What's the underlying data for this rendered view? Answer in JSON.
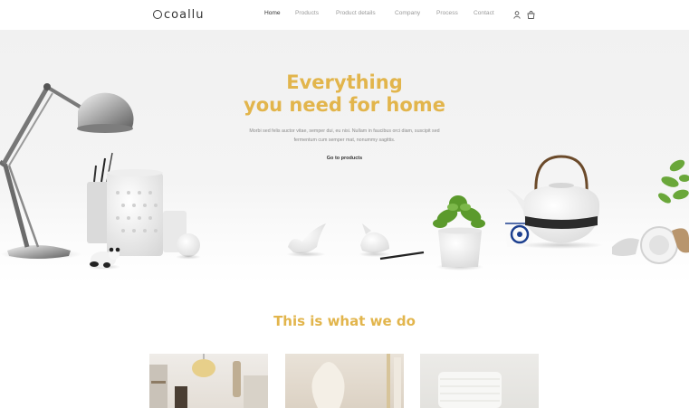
{
  "nav": {
    "logo": "coallu",
    "items": [
      {
        "label": "Home",
        "active": true
      },
      {
        "label": "Products"
      },
      {
        "label": "Product details"
      },
      {
        "label": "Company"
      },
      {
        "label": "Process"
      },
      {
        "label": "Contact"
      }
    ],
    "icons": [
      "user-icon",
      "cart-icon"
    ]
  },
  "hero": {
    "title_line1": "Everything",
    "title_line2": "you need for home",
    "description_line1": "Morbi sed felis auctor vitae, semper dui, eu nisi. Nullam in faucibus orci diam, suscipit sed",
    "description_line2": "fermentum cum semper mat, nonummy sagittis.",
    "cta": "Go to products"
  },
  "section": {
    "title": "This is what we do"
  },
  "colors": {
    "accent": "#e2b54c",
    "text": "#333333",
    "muted": "#9a9a9a",
    "hero_bg": "#f2f2f2"
  }
}
